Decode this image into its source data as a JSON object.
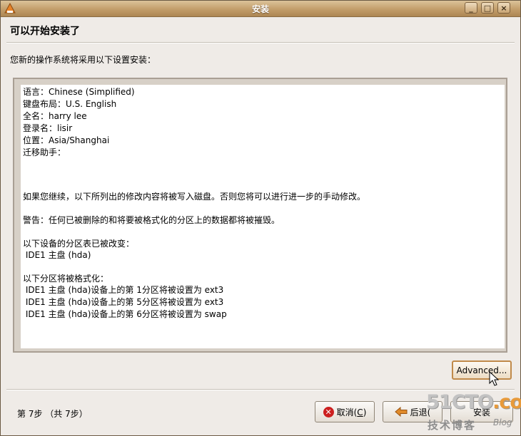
{
  "window": {
    "title": "安装",
    "minimize_glyph": "_",
    "maximize_glyph": "□",
    "close_glyph": "×"
  },
  "heading": "可以开始安装了",
  "subtitle": "您新的操作系统将采用以下设置安装：",
  "summary": {
    "language": "语言：Chinese (Simplified)",
    "keyboard": "键盘布局：U.S. English",
    "fullname": "全名：harry lee",
    "login": "登录名：lisir",
    "location": "位置：Asia/Shanghai",
    "migration": "迁移助手：",
    "continue_notice": "如果您继续，以下所列出的修改内容将被写入磁盘。否则您将可以进行进一步的手动修改。",
    "warning": "警告：任何已被删除的和将要被格式化的分区上的数据都将被摧毁。",
    "partition_table_header": "以下设备的分区表已被改变：",
    "partition_table_device": " IDE1 主盘 (hda)",
    "format_header": "以下分区将被格式化：",
    "format_items": [
      " IDE1 主盘 (hda)设备上的第 1分区将被设置为 ext3",
      " IDE1 主盘 (hda)设备上的第 5分区将被设置为 ext3",
      " IDE1 主盘 (hda)设备上的第 6分区将被设置为 swap"
    ]
  },
  "buttons": {
    "advanced": "Advanced...",
    "cancel_label": "取消(",
    "cancel_mnemonic": "C",
    "cancel_close": ")",
    "back_label": "后退(",
    "install_label": "安装"
  },
  "step": "第 7步 （共 7步）",
  "watermark": {
    "site_a": "51CTO",
    "site_b": ".com",
    "cn": "技术博客",
    "blog": "Blog"
  },
  "colors": {
    "titlebar": "#c29d6a",
    "accent_border": "#c08a4a",
    "cancel_red": "#cc1f1f",
    "back_orange": "#e08a2a"
  },
  "icons": {
    "app": "installer-app-icon",
    "cancel": "cancel-icon",
    "back": "back-arrow-icon",
    "cursor": "mouse-pointer-icon"
  }
}
